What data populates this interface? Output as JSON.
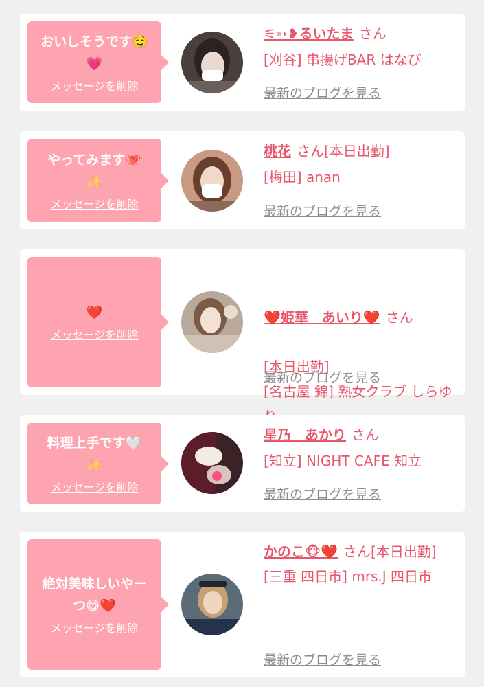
{
  "cards": [
    {
      "message": "おいしそうです🤤\n💗",
      "delete_label": "メッセージを削除",
      "name": "⚟➳❥るいたま",
      "name_suffix": "さん",
      "store": "[刈谷] 串揚げBAR はなび",
      "blog_label": "最新のブログを見る"
    },
    {
      "message": "やってみます🐙\n✨",
      "delete_label": "メッセージを削除",
      "name": "桃花",
      "name_suffix": "さん[本日出勤]",
      "store": "[梅田] anan",
      "blog_label": "最新のブログを見る"
    },
    {
      "message": "❤️",
      "delete_label": "メッセージを削除",
      "name": "❤️姫華　あいり❤️",
      "name_suffix": "さん",
      "store": "[本日出勤]\n[名古屋 錦] 熟女クラブ しらゆり",
      "blog_label": "最新のブログを見る"
    },
    {
      "message": "料理上手です🤍\n✨",
      "delete_label": "メッセージを削除",
      "name": "星乃　あかり",
      "name_suffix": "さん",
      "store": "[知立] NIGHT CAFE 知立",
      "blog_label": "最新のブログを見る"
    },
    {
      "message": "絶対美味しいやーつ😋❤️",
      "delete_label": "メッセージを削除",
      "name": "かのこ🐵❤️",
      "name_suffix": "さん[本日出勤]",
      "store": "[三重 四日市] mrs.J 四日市",
      "blog_label": "最新のブログを見る"
    }
  ],
  "colors": {
    "background": "#f1f0f1",
    "card": "#ffffff",
    "bubble": "#fea4b0",
    "accent": "#e8566b",
    "link_gray": "#8d8d8d"
  }
}
